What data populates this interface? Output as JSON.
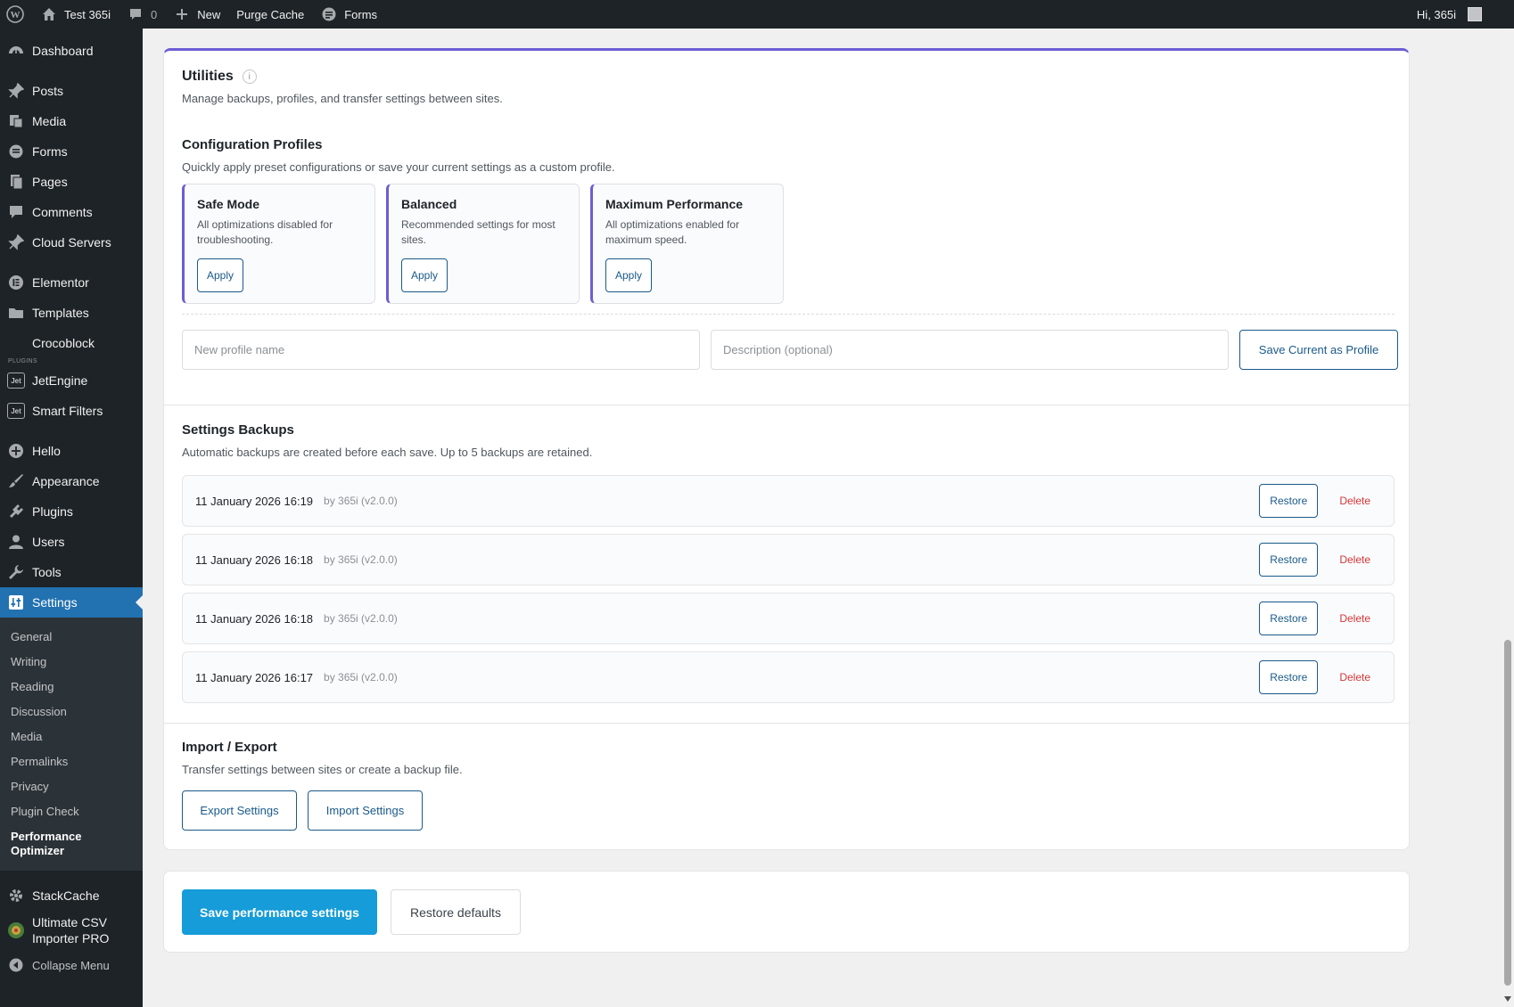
{
  "adminbar": {
    "site_name": "Test 365i",
    "comments_count": "0",
    "new_label": "New",
    "purge_cache_label": "Purge Cache",
    "forms_label": "Forms",
    "greeting": "Hi, 365i"
  },
  "sidebar": {
    "items": [
      {
        "label": "Dashboard",
        "icon": "dashboard-icon"
      },
      {
        "label": "Posts",
        "icon": "pin-icon"
      },
      {
        "label": "Media",
        "icon": "media-icon"
      },
      {
        "label": "Forms",
        "icon": "forms-icon"
      },
      {
        "label": "Pages",
        "icon": "pages-icon"
      },
      {
        "label": "Comments",
        "icon": "comment-icon"
      },
      {
        "label": "Cloud Servers",
        "icon": "pin-icon"
      },
      {
        "label": "Elementor",
        "icon": "elementor-icon"
      },
      {
        "label": "Templates",
        "icon": "folder-icon"
      },
      {
        "label": "Crocoblock",
        "icon": "crocoblock-icon"
      },
      {
        "label": "JetEngine",
        "icon": "jetengine-icon"
      },
      {
        "label": "Smart Filters",
        "icon": "smartfilters-icon"
      },
      {
        "label": "Hello",
        "icon": "plus-circle-icon"
      },
      {
        "label": "Appearance",
        "icon": "brush-icon"
      },
      {
        "label": "Plugins",
        "icon": "plugin-icon"
      },
      {
        "label": "Users",
        "icon": "user-icon"
      },
      {
        "label": "Tools",
        "icon": "wrench-icon"
      },
      {
        "label": "Settings",
        "icon": "settings-icon"
      },
      {
        "label": "StackCache",
        "icon": "gear-icon"
      },
      {
        "label": "Ultimate CSV Importer PRO",
        "icon": "csv-icon"
      },
      {
        "label": "Collapse Menu",
        "icon": "collapse-icon"
      }
    ],
    "plugins_label": "PLUGINS",
    "settings_submenu": [
      "General",
      "Writing",
      "Reading",
      "Discussion",
      "Media",
      "Permalinks",
      "Privacy",
      "Plugin Check",
      "Performance Optimizer"
    ]
  },
  "utilities": {
    "title": "Utilities",
    "info_glyph": "i",
    "subtitle": "Manage backups, profiles, and transfer settings between sites."
  },
  "profiles": {
    "title": "Configuration Profiles",
    "subtitle": "Quickly apply preset configurations or save your current settings as a custom profile.",
    "cards": [
      {
        "name": "Safe Mode",
        "desc": "All optimizations disabled for troubleshooting.",
        "button": "Apply"
      },
      {
        "name": "Balanced",
        "desc": "Recommended settings for most sites.",
        "button": "Apply"
      },
      {
        "name": "Maximum Performance",
        "desc": "All optimizations enabled for maximum speed.",
        "button": "Apply"
      }
    ],
    "name_placeholder": "New profile name",
    "desc_placeholder": "Description (optional)",
    "save_button": "Save Current as Profile"
  },
  "backups": {
    "title": "Settings Backups",
    "subtitle": "Automatic backups are created before each save. Up to 5 backups are retained.",
    "rows": [
      {
        "date": "11 January 2026 16:19",
        "meta": "by 365i (v2.0.0)",
        "restore": "Restore",
        "delete": "Delete"
      },
      {
        "date": "11 January 2026 16:18",
        "meta": "by 365i (v2.0.0)",
        "restore": "Restore",
        "delete": "Delete"
      },
      {
        "date": "11 January 2026 16:18",
        "meta": "by 365i (v2.0.0)",
        "restore": "Restore",
        "delete": "Delete"
      },
      {
        "date": "11 January 2026 16:17",
        "meta": "by 365i (v2.0.0)",
        "restore": "Restore",
        "delete": "Delete"
      }
    ]
  },
  "import_export": {
    "title": "Import / Export",
    "subtitle": "Transfer settings between sites or create a backup file.",
    "export_button": "Export Settings",
    "import_button": "Import Settings"
  },
  "footer": {
    "save_button": "Save performance settings",
    "restore_button": "Restore defaults"
  },
  "colors": {
    "accent": "#6d5dd3",
    "primary": "#169cd8",
    "link": "#1a5a8a",
    "danger": "#d63638",
    "admin_dark": "#1d2327",
    "active_menu": "#2271b1"
  }
}
